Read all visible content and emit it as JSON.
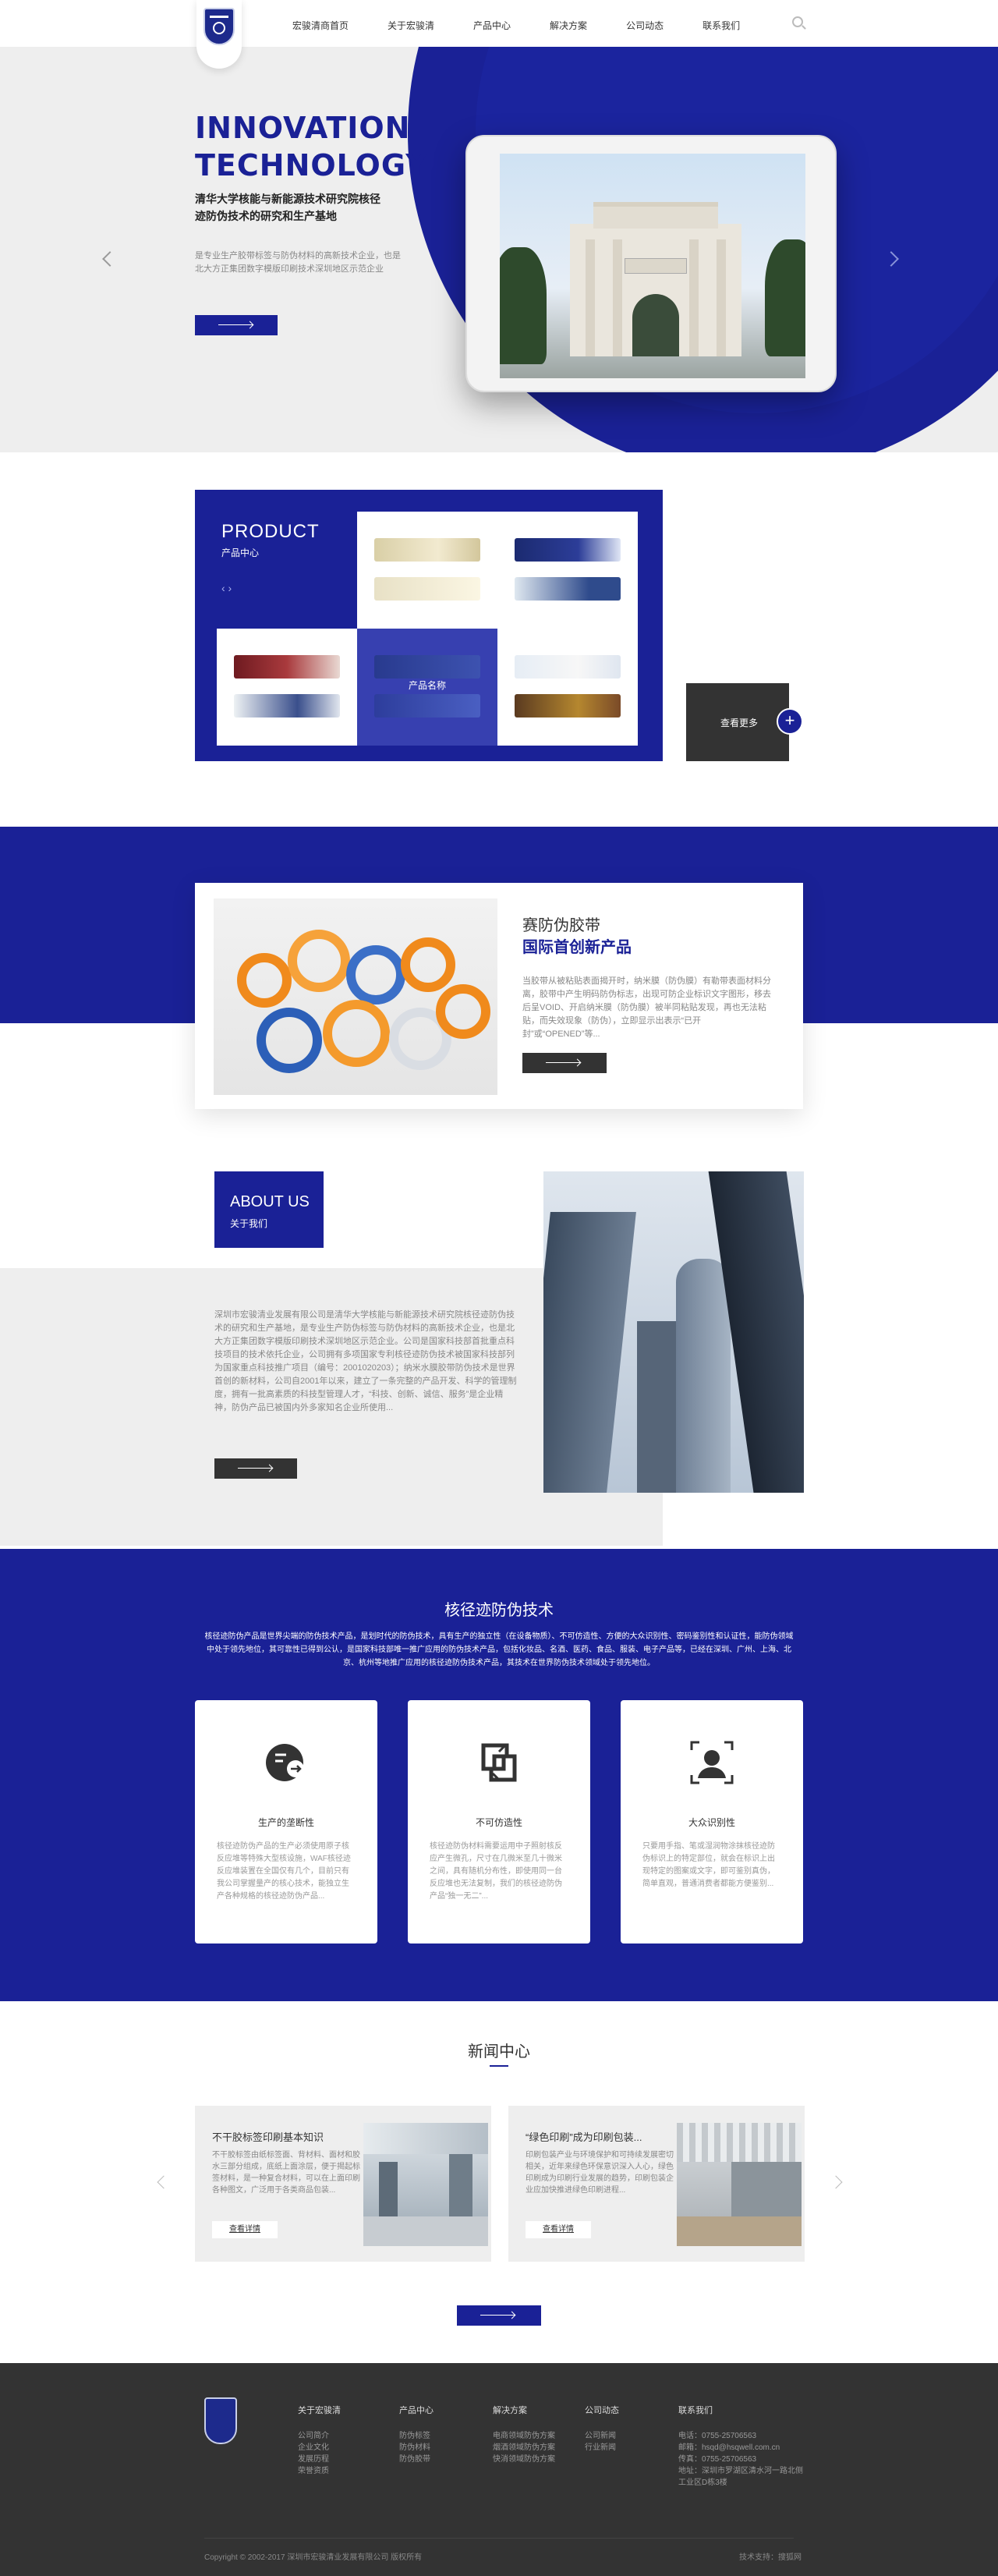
{
  "nav": {
    "items": [
      "宏骏清商首页",
      "关于宏骏清",
      "产品中心",
      "解决方案",
      "公司动态",
      "联系我们"
    ]
  },
  "hero": {
    "title_line1": "INNOVATION",
    "title_line2": "TECHNOLOGY",
    "subtitle": "清华大学核能与新能源技术研究院核径迹防伪技术的研究和生产基地",
    "desc": "是专业生产胶带标签与防伪材料的高新技术企业，也是北大方正集团数字模版印刷技术深圳地区示范企业"
  },
  "product": {
    "title": "PRODUCT",
    "subtitle": "产品中心",
    "arrows": "‹  ›",
    "cell_name": "产品名称",
    "more": "查看更多",
    "plus": "+"
  },
  "tape": {
    "title": "赛防伪胶带",
    "headline": "国际首创新产品",
    "desc": "当胶带从被粘贴表面揭开时，纳米膜（防伪膜）有勒带表面材料分离，胶带中产生明码防伪标志，出现可防企业标识文字图形，移去后呈VOID、开启纳米膜（防伪膜）被半同粘贴发现，再也无法粘贴，而失效现象（防伪），立即显示出表示“已开封”或“OPENED”等..."
  },
  "about": {
    "title": "ABOUT US",
    "subtitle": "关于我们",
    "desc": "深圳市宏骏清业发展有限公司是清华大学核能与新能源技术研究院核径迹防伪技术的研究和生产基地，是专业生产防伪标签与防伪材料的高新技术企业，也是北大方正集团数字模版印刷技术深圳地区示范企业。公司是国家科技部首批重点科技项目的技术依托企业，公司拥有多项国家专利核径迹防伪技术被国家科技部列为国家重点科技推广项目（编号：2001020203）；纳米水膜胶带防伪技术是世界首创的新材料，公司自2001年以来，建立了一条完整的产品开发、科学的管理制度，拥有一批高素质的科技型管理人才，“科技、创新、诚信、服务”是企业精神，防伪产品已被国内外多家知名企业所使用..."
  },
  "tech": {
    "title": "核径迹防伪技术",
    "desc": "核径迹防伪产品是世界尖端的防伪技术产品，是划时代的防伪技术，具有生产的独立性（在设备物质）、不可仿造性、方便的大众识别性、密码鉴别性和认证性，能防伪领域中处于领先地位，其可靠性已得到公认，是国家科技部唯一推广应用的防伪技术产品，包括化妆品、名酒、医药、食品、服装、电子产品等，已经在深圳、广州、上海、北京、杭州等地推广应用的核径迹防伪技术产品，其技术在世界防伪技术领域处于领先地位。",
    "cards": [
      {
        "icon": "arrow-circle-icon",
        "title": "生产的垄断性",
        "desc": "核径迹防伪产品的生产必须使用原子核反应堆等特殊大型核设施，WAF核径迹反应堆装置在全国仅有几个，目前只有我公司掌握量产的核心技术，能独立生产各种规格的核径迹防伪产品..."
      },
      {
        "icon": "swap-icon",
        "title": "不可仿造性",
        "desc": "核径迹防伪材料需要运用中子照射核反应产生微孔，尺寸在几微米至几十微米之间，具有随机分布性，即使用同一台反应堆也无法复制，我们的核径迹防伪产品“独一无二”..."
      },
      {
        "icon": "user-scan-icon",
        "title": "大众识别性",
        "desc": "只要用手指、笔或湿润物涂抹核径迹防伪标识上的特定部位，就会在标识上出现特定的图案或文字，即可鉴别真伪，简单直观，普通消费者都能方便鉴别..."
      }
    ]
  },
  "news": {
    "title": "新闻中心",
    "items": [
      {
        "title": "不干胶标签印刷基本知识",
        "desc": "不干胶标签由纸标签面、背材料、面材和胶水三部分组成，底纸上面涂层，便于揭起标签材料，是一种复合材料，可以在上面印刷各种图文，广泛用于各类商品包装...",
        "btn": "查看详情"
      },
      {
        "title": "“绿色印刷”成为印刷包装...",
        "desc": "印刷包装产业与环境保护和可持续发展密切相关，近年来绿色环保意识深入人心，绿色印刷成为印刷行业发展的趋势，印刷包装企业应加快推进绿色印刷进程...",
        "btn": "查看详情"
      }
    ]
  },
  "footer": {
    "cols": [
      {
        "title": "关于宏骏清",
        "links": [
          "公司简介",
          "企业文化",
          "发展历程",
          "荣誉资质"
        ]
      },
      {
        "title": "产品中心",
        "links": [
          "防伪标签",
          "防伪材料",
          "防伪胶带"
        ]
      },
      {
        "title": "解决方案",
        "links": [
          "电商领域防伪方案",
          "烟酒领域防伪方案",
          "快消领域防伪方案"
        ]
      },
      {
        "title": "公司动态",
        "links": [
          "公司新闻",
          "行业新闻"
        ]
      },
      {
        "title": "联系我们",
        "links": [
          "电话：0755-25706563",
          "邮箱：hsqd@hsqwell.com.cn",
          "传真：0755-25706563",
          "地址：深圳市罗湖区清水河一路北侧",
          "工业区D栋3楼"
        ]
      }
    ],
    "copyright": "Copyright © 2002-2017 深圳市宏骏清业发展有限公司 版权所有",
    "tech_support": "技术支持：搜狐网"
  },
  "colors": {
    "brand": "#1a2196",
    "dark": "#333333",
    "grey": "#eeeeee"
  }
}
